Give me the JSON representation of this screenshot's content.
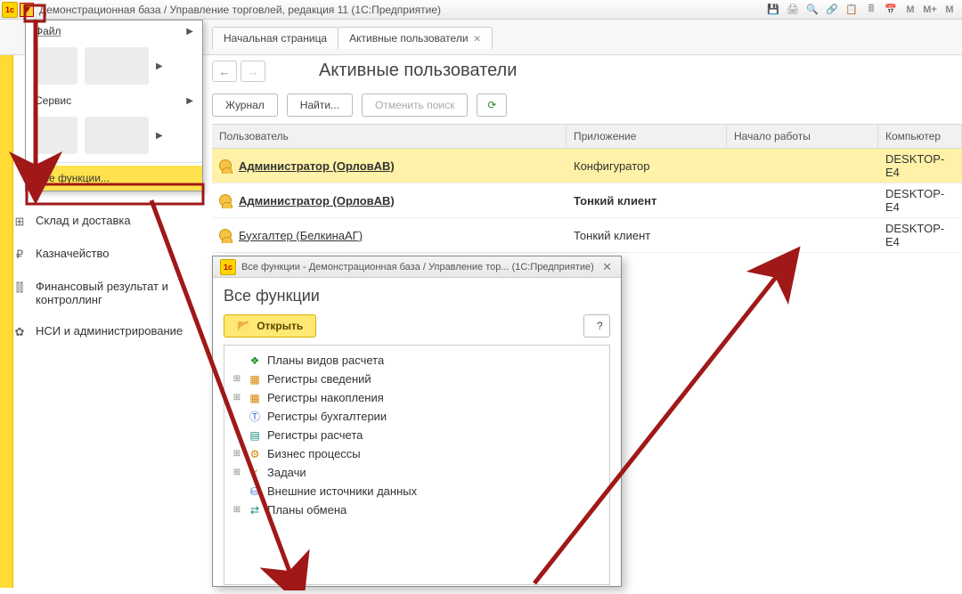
{
  "titlebar": {
    "text": "Демонстрационная база / Управление торговлей, редакция 11 (1С:Предприятие)"
  },
  "titlebar_letters": {
    "m": "M",
    "mplus": "M+",
    "mcap": "M"
  },
  "dropdown": {
    "file": "Файл",
    "service": "Сервис",
    "all_functions": "Все функции..."
  },
  "tabs": {
    "start": "Начальная страница",
    "active": "Активные пользователи"
  },
  "sidebar": {
    "items": [
      {
        "icon": "⊞",
        "label": "Склад и доставка"
      },
      {
        "icon": "₽",
        "label": "Казначейство"
      },
      {
        "icon": "⫿⫿",
        "label": "Финансовый результат и контроллинг"
      },
      {
        "icon": "✿",
        "label": "НСИ и администрирование"
      }
    ]
  },
  "page": {
    "title": "Активные пользователи",
    "btn_journal": "Журнал",
    "btn_find": "Найти...",
    "btn_cancel": "Отменить поиск"
  },
  "columns": {
    "user": "Пользователь",
    "app": "Приложение",
    "start": "Начало работы",
    "comp": "Компьютер"
  },
  "rows": [
    {
      "user": "Администратор (ОрловАВ)",
      "app": "Конфигуратор",
      "comp": "DESKTOP-E4"
    },
    {
      "user": "Администратор (ОрловАВ)",
      "app": "Тонкий клиент",
      "comp": "DESKTOP-E4"
    },
    {
      "user": "Бухгалтер (БелкинаАГ)",
      "app": "Тонкий клиент",
      "comp": "DESKTOP-E4"
    }
  ],
  "dialog": {
    "title": "Все функции - Демонстрационная база / Управление тор... (1С:Предприятие)",
    "heading": "Все функции",
    "open": "Открыть",
    "q": "?",
    "tree": [
      {
        "exp": "",
        "color": "green",
        "glyph": "❖",
        "label": "Планы видов расчета"
      },
      {
        "exp": "⊞",
        "color": "orange",
        "glyph": "▦",
        "label": "Регистры сведений"
      },
      {
        "exp": "⊞",
        "color": "orange",
        "glyph": "▦",
        "label": "Регистры накопления"
      },
      {
        "exp": "",
        "color": "blue",
        "glyph": "Ⓣ",
        "label": "Регистры бухгалтерии"
      },
      {
        "exp": "",
        "color": "teal",
        "glyph": "▤",
        "label": "Регистры расчета"
      },
      {
        "exp": "⊞",
        "color": "orange",
        "glyph": "⚙",
        "label": "Бизнес процессы"
      },
      {
        "exp": "⊞",
        "color": "orange",
        "glyph": "✓",
        "label": "Задачи"
      },
      {
        "exp": "",
        "color": "blue",
        "glyph": "⛁",
        "label": "Внешние источники данных"
      },
      {
        "exp": "⊞",
        "color": "teal",
        "glyph": "⇄",
        "label": "Планы обмена"
      }
    ]
  }
}
